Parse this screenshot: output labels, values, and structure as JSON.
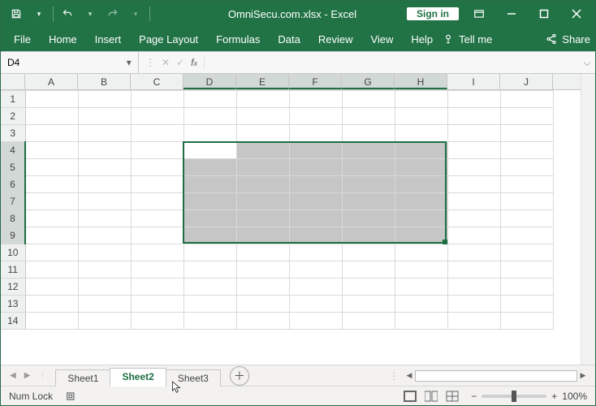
{
  "titlebar": {
    "doc_title": "OmniSecu.com.xlsx",
    "app_name": "Excel",
    "signin_label": "Sign in"
  },
  "ribbon": {
    "tabs": [
      "File",
      "Home",
      "Insert",
      "Page Layout",
      "Formulas",
      "Data",
      "Review",
      "View",
      "Help"
    ],
    "tellme": "Tell me",
    "share": "Share"
  },
  "formulabar": {
    "namebox_value": "D4",
    "formula_value": ""
  },
  "grid": {
    "columns": [
      "A",
      "B",
      "C",
      "D",
      "E",
      "F",
      "G",
      "H",
      "I",
      "J"
    ],
    "rows": [
      "1",
      "2",
      "3",
      "4",
      "5",
      "6",
      "7",
      "8",
      "9",
      "10",
      "11",
      "12",
      "13",
      "14"
    ],
    "selected_cols": [
      "D",
      "E",
      "F",
      "G",
      "H"
    ],
    "selected_rows": [
      "4",
      "5",
      "6",
      "7",
      "8",
      "9"
    ],
    "active_cell": "D4"
  },
  "sheets": {
    "tabs": [
      "Sheet1",
      "Sheet2",
      "Sheet3"
    ],
    "active_index": 1
  },
  "statusbar": {
    "mode": "Num Lock",
    "zoom": "100%"
  },
  "colors": {
    "primary": "#217346"
  }
}
